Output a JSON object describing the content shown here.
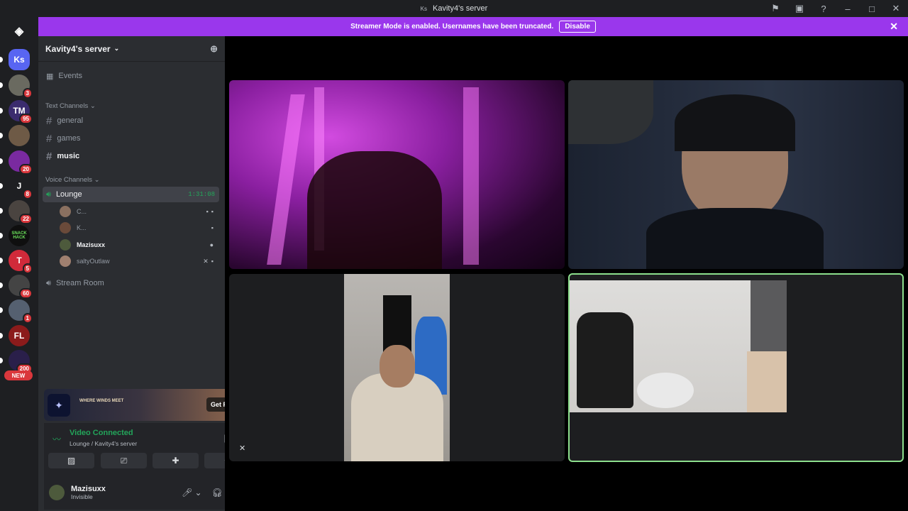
{
  "window": {
    "title": "Kavity4's server",
    "server_abbrev": "Ks"
  },
  "banner": {
    "text": "Streamer Mode is enabled. Usernames have been truncated.",
    "button": "Disable"
  },
  "guilds": [
    {
      "label": "Ks",
      "badge": "",
      "color": "#5865f2"
    },
    {
      "label": "",
      "badge": "3",
      "color": "#6a6a60"
    },
    {
      "label": "TM",
      "badge": "95",
      "color": "#3b2c6e"
    },
    {
      "label": "",
      "badge": "",
      "color": "#6e5a46"
    },
    {
      "label": "",
      "badge": "20",
      "color": "#7a2aa0"
    },
    {
      "label": "J",
      "badge": "8",
      "color": "#1e1f22"
    },
    {
      "label": "",
      "badge": "22",
      "color": "#4a4440"
    },
    {
      "label": "SNACK HACK",
      "badge": "",
      "color": "#0f0f0f"
    },
    {
      "label": "T",
      "badge": "5",
      "color": "#d12a3a"
    },
    {
      "label": "",
      "badge": "60",
      "color": "#444"
    },
    {
      "label": "",
      "badge": "1",
      "color": "#556070"
    },
    {
      "label": "FL",
      "badge": "",
      "color": "#8b1b1b"
    },
    {
      "label": "",
      "badge": "200",
      "color": "#2a1f4a"
    }
  ],
  "guild_new_label": "NEW",
  "sidebar": {
    "server_name": "Kavity4's server",
    "events": "Events",
    "text_category": "Text Channels",
    "text_channels": [
      "general",
      "games",
      "music"
    ],
    "voice_category": "Voice Channels",
    "voice_channel": "Lounge",
    "voice_timer": "1:31:08",
    "voice_users": [
      "C...",
      "K...",
      "Mazisuxx",
      "saltyOutlaw"
    ],
    "stream_room": "Stream Room"
  },
  "promo": {
    "game_tag": "WHERE WINDS MEET",
    "button": "Get Reward!"
  },
  "voice_panel": {
    "status": "Video Connected",
    "location": "Lounge / Kavity4's server"
  },
  "user": {
    "name": "Mazisuxx",
    "status": "Invisible"
  },
  "colors": {
    "accent_banner": "#9a37ec",
    "connected": "#23a55a",
    "speaking_border": "#8de08d"
  },
  "icons": [
    "discord-icon",
    "flag-icon",
    "inbox-icon",
    "help-icon",
    "add-member-icon",
    "calendar-icon",
    "speaker-icon",
    "camera-icon",
    "mute-icon",
    "soundboard-icon",
    "disconnect-icon",
    "microphone-icon",
    "headphones-icon",
    "settings-icon"
  ]
}
